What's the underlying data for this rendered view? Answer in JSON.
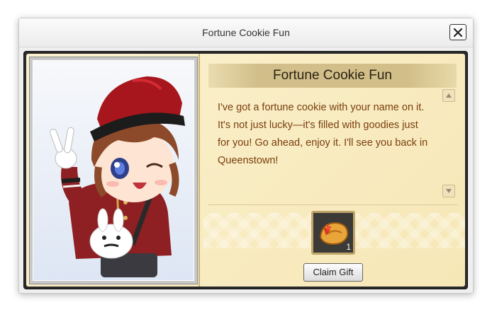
{
  "window": {
    "title": "Fortune Cookie Fun",
    "close_label": "close"
  },
  "dialog": {
    "header": "Fortune Cookie Fun",
    "lines": [
      "I've got a fortune cookie with your name on it.",
      "It's not just lucky—it's filled with goodies just",
      "for you! Go ahead, enjoy it. I'll see you back in",
      "Queenstown!"
    ]
  },
  "reward": {
    "item_icon": "fortune-cookie-icon",
    "quantity": "1"
  },
  "actions": {
    "claim_label": "Claim Gift"
  },
  "colors": {
    "dialog_text": "#7a3e0d",
    "panel_bg": "#f6e7b6",
    "frame": "#2a2a2a"
  }
}
